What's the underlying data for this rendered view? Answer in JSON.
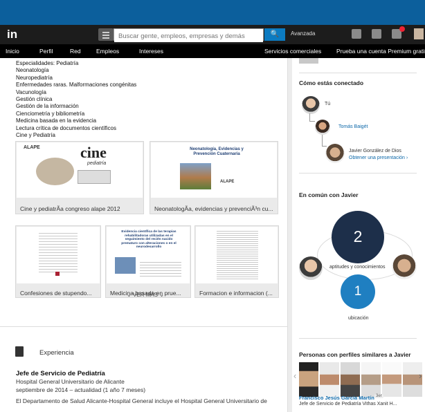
{
  "topbar": {
    "logo": "in",
    "search_placeholder": "Buscar gente, empleos, empresas y demás",
    "search_icon": "search-icon",
    "advanced": "Avanzada"
  },
  "nav": {
    "items": [
      "Inicio",
      "Perfil",
      "Red",
      "Empleos",
      "Intereses"
    ],
    "right_items": [
      "Servicios comerciales",
      "Prueba una cuenta Premium gratis"
    ]
  },
  "left": {
    "specialties": [
      "Especialidades: Pediatría",
      "Neonatología",
      "Neuropediatría",
      "Enfermedades raras. Malformaciones congénitas",
      "Vacunología",
      "Gestión clínica",
      "Gestión de la información",
      "Cienciometría y bibliometría",
      "Medicina basada en la evidencia",
      "Lectura crítica de documentos científicos",
      "Cine y Pediatría"
    ],
    "cards_row1": [
      {
        "caption": "Cine y pediatrÃa congreso alape 2012",
        "thumb_title": "cine",
        "thumb_sub": "pediatría",
        "badge": "ALAPE"
      },
      {
        "caption": "NeonatologÃa, evidencias y prevenciÃ³n cu...",
        "thumb_title": "Neonatología, Evidencias y Prevención Cuaternaria",
        "badge": "ALAPE"
      }
    ],
    "cards_row2": [
      {
        "caption": "Confesiones de stupendo..."
      },
      {
        "caption": "Medicina basada en prue...",
        "thumb_title": "Evidencia científica de las terapias rehabilitadoras utilizadas en el seguimiento del recién nacido prematuro con alteraciones o en el neurodesarrollo"
      },
      {
        "caption": "Formacion e informacion (..."
      }
    ],
    "ver_mas": "VER MÁS",
    "experience_title": "Experiencia",
    "job_title": "Jefe de Servicio de Pediatría",
    "employer": "Hospital General Universitario de Alicante",
    "dates": "septiembre de 2014 – actualidad (1 año 7 meses)",
    "description": "El Departamento de Salud Alicante-Hospital General incluye el Hospital General Universitario de"
  },
  "right": {
    "connected_title": "Cómo estás conectado",
    "you": "Tú",
    "tomas": "Tomás Baigét",
    "javier": "Javier González de Dios",
    "intro": "Obtener una presentación",
    "common_title": "En común con Javier",
    "skills_count": "2",
    "skills_label": "aptitudes y conocimientos",
    "location_count": "1",
    "location_label": "ubicación",
    "similar_title": "Personas con perfiles similares a Javier",
    "similar_name": "Francisco Jesús García Martín",
    "similar_degree": "3er",
    "similar_role": "Jefe de Servicio de Pediatría Vithas Xanit H..."
  },
  "colors": {
    "brand_blue": "#0c5f9c",
    "link": "#0b67a8",
    "dark_circle": "#1d2f4a",
    "blue_circle": "#1f7fc1"
  }
}
